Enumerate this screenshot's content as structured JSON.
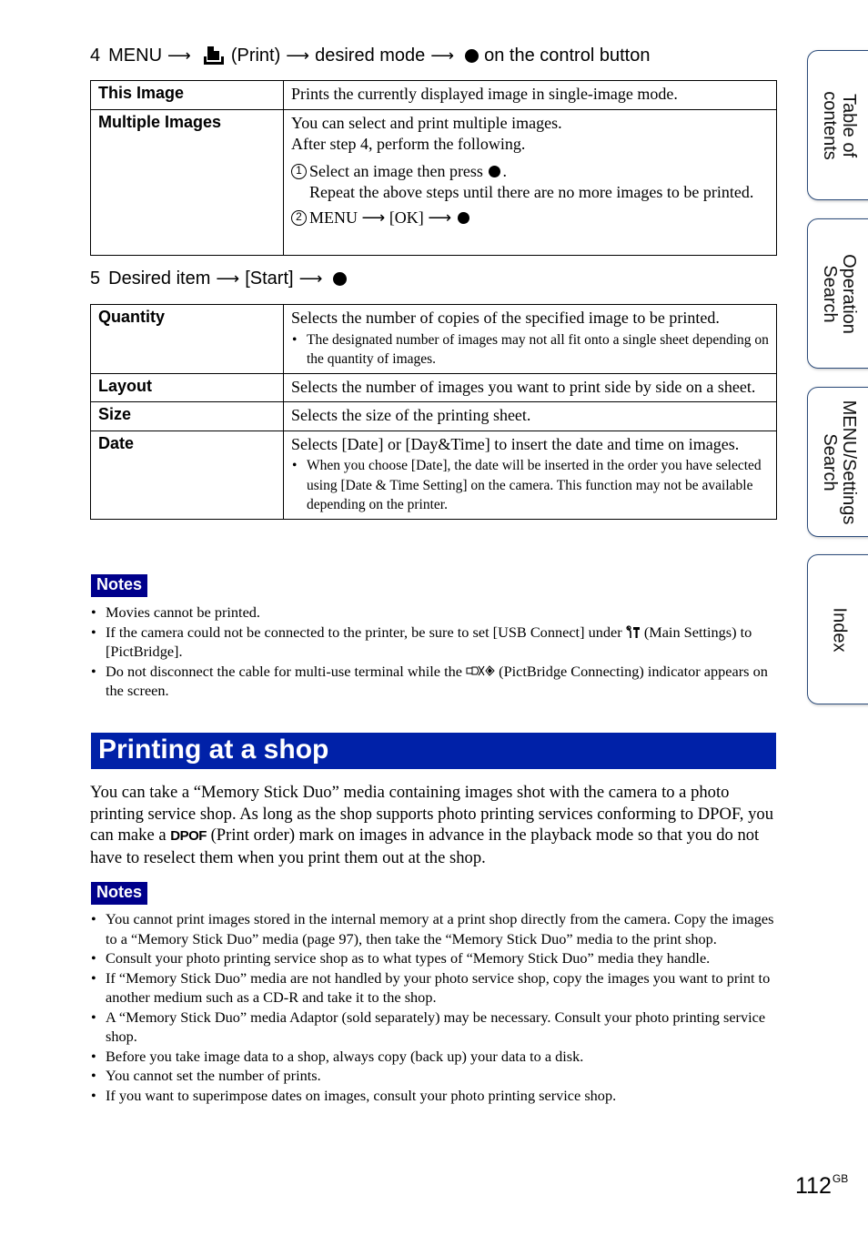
{
  "step4": {
    "number": "4",
    "menu": "MENU",
    "print_label": "(Print)",
    "desired_mode": "desired mode",
    "control_text": "on the control button",
    "icons": [
      "right-arrow",
      "print-icon",
      "right-arrow",
      "right-arrow",
      "center-button-dot"
    ]
  },
  "table1": {
    "rows": [
      {
        "key": "This Image",
        "text": "Prints the currently displayed image in single-image mode."
      },
      {
        "key": "Multiple Images",
        "lines": [
          "You can select and print multiple images.",
          "After step 4, perform the following."
        ],
        "substeps": [
          {
            "num": "1",
            "text": "Select an image then press",
            "after": ".",
            "cont": "Repeat the above steps until there are no more images to be printed."
          },
          {
            "num": "2",
            "menu": "MENU",
            "ok": "[OK]"
          }
        ]
      }
    ]
  },
  "step5": {
    "number": "5",
    "item": "Desired item",
    "start": "[Start]"
  },
  "table2": {
    "rows": [
      {
        "key": "Quantity",
        "text": "Selects the number of copies of the specified image to be printed.",
        "note": "The designated number of images may not all fit onto a single sheet depending on the quantity of images."
      },
      {
        "key": "Layout",
        "text": "Selects the number of images you want to print side by side on a sheet."
      },
      {
        "key": "Size",
        "text": "Selects the size of the printing sheet."
      },
      {
        "key": "Date",
        "text": "Selects [Date] or [Day&Time] to insert the date and time on images.",
        "note": "When you choose [Date], the date will be inserted in the order you have selected using [Date & Time Setting] on the camera. This function may not be available depending on the printer."
      }
    ]
  },
  "notes1": {
    "label": "Notes",
    "items": [
      {
        "text": "Movies cannot be printed."
      },
      {
        "before": "If the camera could not be connected to the printer, be sure to set [USB Connect] under",
        "icon": "main-settings-icon",
        "after": "(Main Settings) to [PictBridge]."
      },
      {
        "before": "Do not disconnect the cable for multi-use terminal while the",
        "icon": "pictbridge-connecting-icon",
        "after": "(PictBridge Connecting) indicator appears on the screen."
      }
    ]
  },
  "section": {
    "title": "Printing at a shop",
    "para_before": "You can take a “Memory Stick Duo” media containing images shot with the camera to a photo printing service shop. As long as the shop supports photo printing services conforming to DPOF, you can make a",
    "dpof_mark": "DPOF",
    "para_after": "(Print order) mark on images in advance in the playback mode so that you do not have to reselect them when you print them out at the shop."
  },
  "notes2": {
    "label": "Notes",
    "items": [
      "You cannot print images stored in the internal memory at a print shop directly from the camera. Copy the images to a “Memory Stick Duo” media (page 97), then take the “Memory Stick Duo” media to the print shop.",
      "Consult your photo printing service shop as to what types of “Memory Stick Duo” media they handle.",
      "If “Memory Stick Duo” media are not handled by your photo service shop, copy the images you want to print to another medium such as a CD-R and take it to the shop.",
      "A “Memory Stick Duo” media Adaptor (sold separately) may be necessary. Consult your photo printing service shop.",
      "Before you take image data to a shop, always copy (back up) your data to a disk.",
      "You cannot set the number of prints.",
      "If you want to superimpose dates on images, consult your photo printing service shop."
    ]
  },
  "side_tabs": [
    {
      "line1": "Table of",
      "line2": "contents"
    },
    {
      "line1": "Operation",
      "line2": "Search"
    },
    {
      "line1": "MENU/Settings",
      "line2": "Search"
    },
    {
      "line1": "Index",
      "line2": ""
    }
  ],
  "page": {
    "number": "112",
    "suffix": "GB"
  },
  "colors": {
    "section_bg": "#0021a8",
    "notes_bg": "#00008b",
    "tab_border": "#2b4b7a"
  }
}
